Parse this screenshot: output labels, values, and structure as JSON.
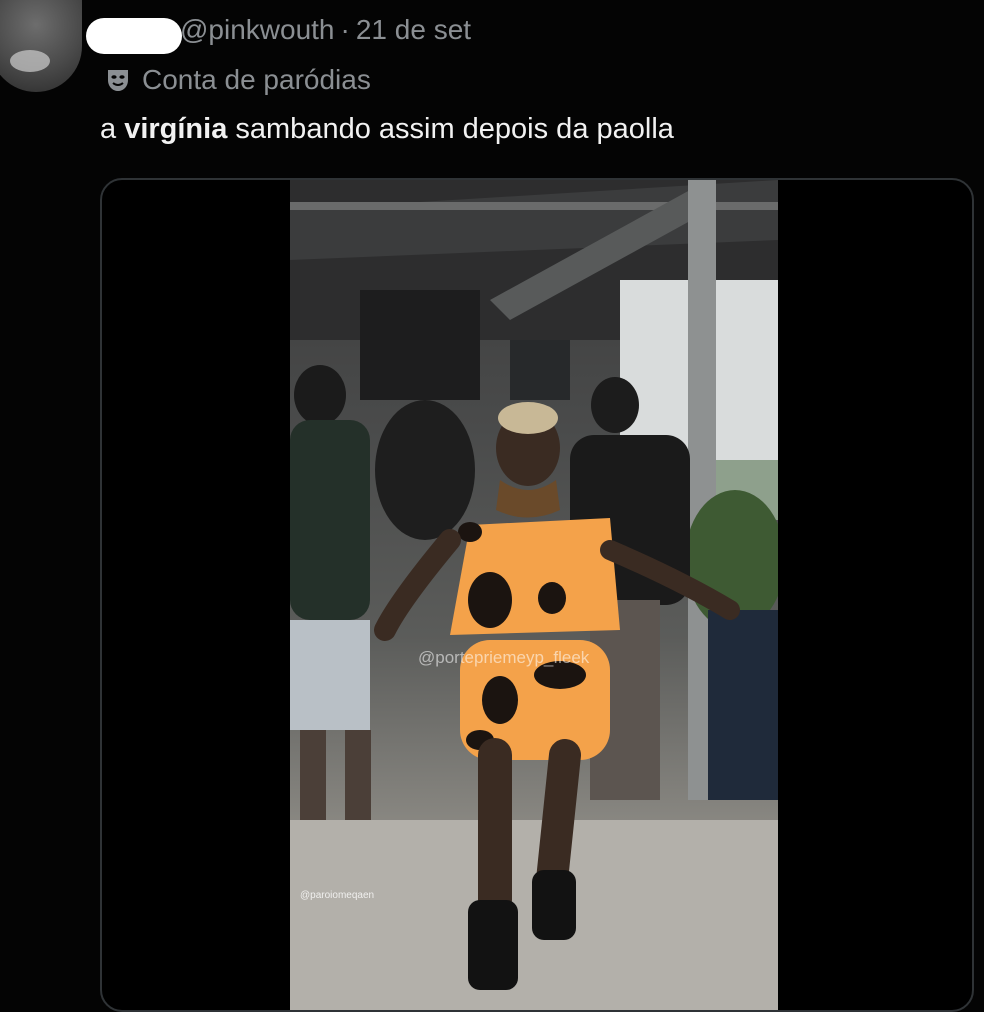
{
  "tweet": {
    "handle": "@pinkwouth",
    "separator": "·",
    "date": "21 de set",
    "label": "Conta de paródias",
    "text_bold": "virgínia",
    "text_prefix": "a ",
    "text_suffix": " sambando assim depois da paolla"
  },
  "media": {
    "watermark": "@portepriemeyp_fleek",
    "overlay_credit": "@paroiomeqaen"
  },
  "icons": {
    "parody": "theater-mask-icon"
  },
  "colors": {
    "background": "#040404",
    "muted_text": "#8b8f93",
    "main_text": "#f2f2f2",
    "outfit": "#f4a24a"
  }
}
